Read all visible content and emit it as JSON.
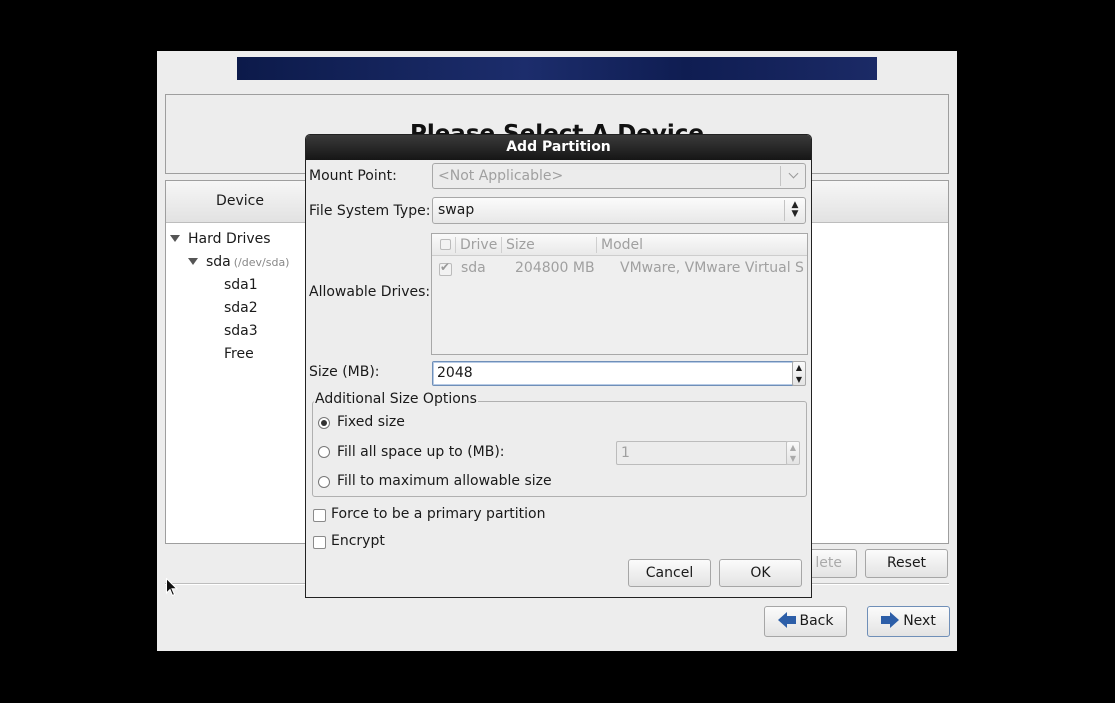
{
  "page": {
    "title": "Please Select A Device",
    "device_column": "Device"
  },
  "tree": {
    "hard_drives": "Hard Drives",
    "disk": "sda",
    "disk_path": "(/dev/sda)",
    "partitions": [
      "sda1",
      "sda2",
      "sda3",
      "Free"
    ]
  },
  "buttons": {
    "delete": "lete",
    "reset": "Reset",
    "back": "Back",
    "next": "Next"
  },
  "dialog": {
    "title": "Add Partition",
    "mount_point_label": "Mount Point:",
    "mount_point_value": "<Not Applicable>",
    "fs_type_label": "File System Type:",
    "fs_type_value": "swap",
    "allowable_drives_label": "Allowable Drives:",
    "drives_columns": [
      "Drive",
      "Size",
      "Model"
    ],
    "drives_rows": [
      {
        "checked": true,
        "drive": "sda",
        "size": "204800 MB",
        "model": "VMware, VMware Virtual S"
      }
    ],
    "size_label": "Size (MB):",
    "size_value": "2048",
    "size_options_legend": "Additional Size Options",
    "fixed_size": "Fixed size",
    "fill_up_to": "Fill all space up to (MB):",
    "fill_up_to_value": "1",
    "fill_max": "Fill to maximum allowable size",
    "selected_size_option": "Fixed size",
    "force_primary": "Force to be a primary partition",
    "force_primary_checked": false,
    "encrypt": "Encrypt",
    "encrypt_checked": false,
    "cancel": "Cancel",
    "ok": "OK"
  },
  "icons": {
    "back": "arrow-left-icon",
    "next": "arrow-right-icon",
    "expander": "triangle-down-icon"
  },
  "colors": {
    "accent_arrow": "#2c5ea8",
    "banner": "#1c2d6c",
    "dialog_titlebar": "#1f1f1f"
  }
}
